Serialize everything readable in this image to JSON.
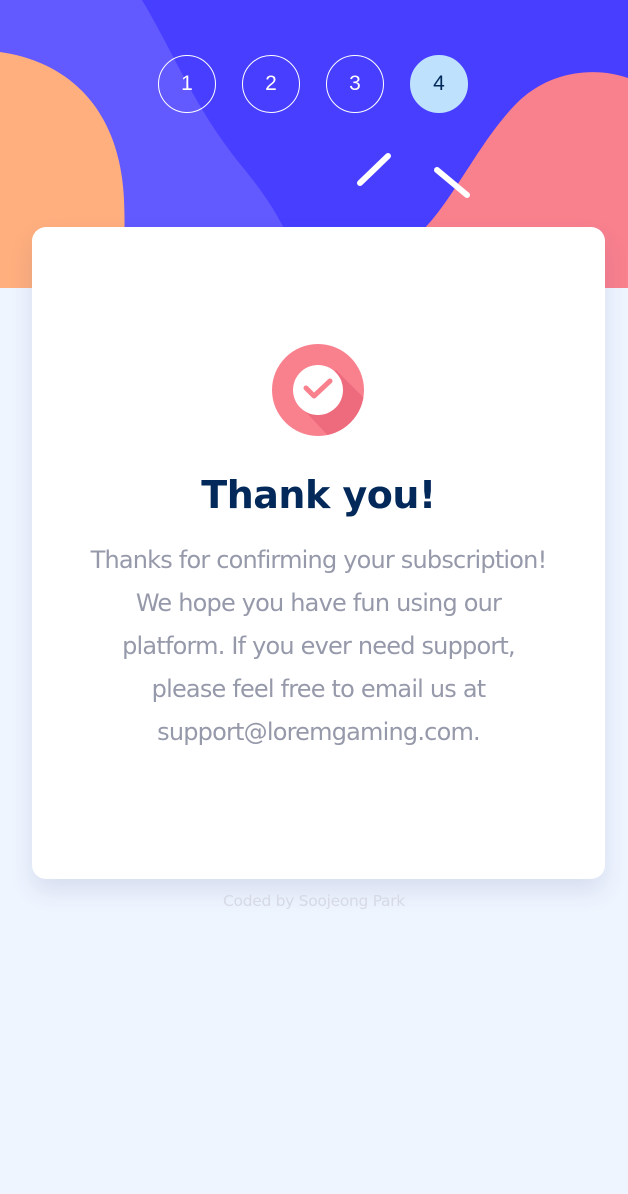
{
  "colors": {
    "hero_blue": "#483eff",
    "hero_violet": "#6259ff",
    "hero_orange": "#ffaf7e",
    "hero_pink": "#f9818e",
    "page_background": "#eff5ff",
    "title": "#022959",
    "text_muted": "#9699aa",
    "active_step": "#bee2fd"
  },
  "steps": [
    {
      "label": "1",
      "active": false
    },
    {
      "label": "2",
      "active": false
    },
    {
      "label": "3",
      "active": false
    },
    {
      "label": "4",
      "active": true
    }
  ],
  "confirmation": {
    "icon": "checkmark-icon",
    "title": "Thank you!",
    "message_lines": [
      "Thanks for confirming your subscription!",
      "We hope you have fun using our",
      "platform. If you ever need support,",
      "please feel free to email us at",
      "support@loremgaming.com."
    ]
  },
  "footer": {
    "credit": "Coded by Soojeong Park"
  }
}
